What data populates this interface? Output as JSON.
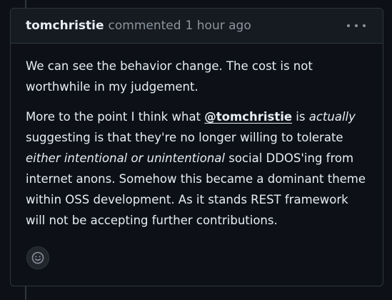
{
  "comment": {
    "author": "tomchristie",
    "action": "commented",
    "time": "1 hour ago",
    "options_icon": "kebab-horizontal-icon",
    "paragraph1": "We can see the behavior change. The cost is not worthwhile in my judgement.",
    "paragraph2": {
      "part1": "More to the point I think what ",
      "mention": "@tomchristie",
      "part2": " is ",
      "em1": "actually",
      "part3": " suggesting is that they're no longer willing to tolerate ",
      "em2": "either intentional or unintentional",
      "part4": " social DDOS'ing from internet anons. Somehow this became a dominant theme within OSS development. As it stands REST framework will not be accepting further contributions."
    },
    "reaction_icon": "smiley-icon"
  },
  "colors": {
    "background": "#0d1117",
    "header_background": "#161b22",
    "border": "#30363d",
    "text": "#e6edf3",
    "muted_text": "#8b949e"
  }
}
